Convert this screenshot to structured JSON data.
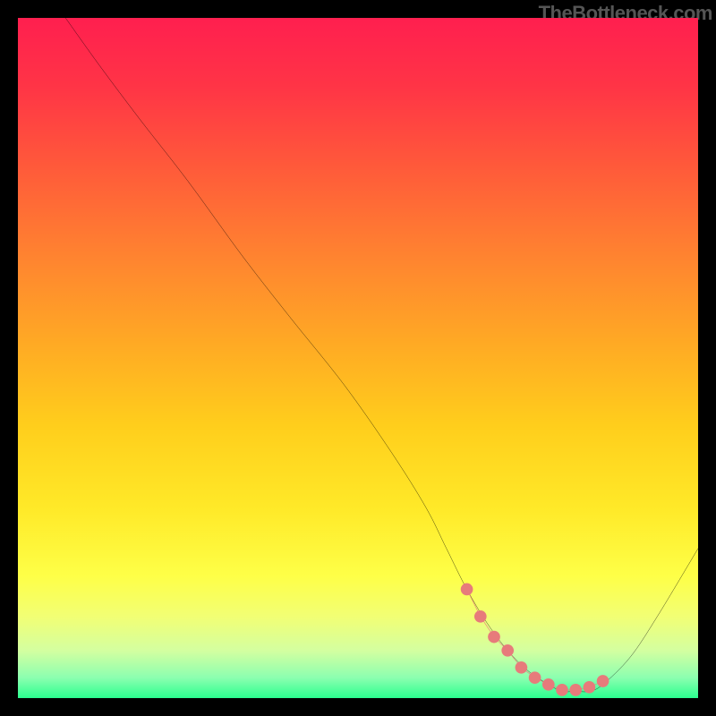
{
  "attribution": "TheBottleneck.com",
  "gradient_stops": [
    {
      "offset": 0.0,
      "color": "#ff1f4f"
    },
    {
      "offset": 0.1,
      "color": "#ff3446"
    },
    {
      "offset": 0.22,
      "color": "#ff5a3a"
    },
    {
      "offset": 0.35,
      "color": "#ff8330"
    },
    {
      "offset": 0.48,
      "color": "#ffaa24"
    },
    {
      "offset": 0.6,
      "color": "#ffce1c"
    },
    {
      "offset": 0.72,
      "color": "#ffe928"
    },
    {
      "offset": 0.82,
      "color": "#feff47"
    },
    {
      "offset": 0.88,
      "color": "#f2ff74"
    },
    {
      "offset": 0.93,
      "color": "#d4ffa0"
    },
    {
      "offset": 0.97,
      "color": "#8cffb0"
    },
    {
      "offset": 1.0,
      "color": "#2bff8f"
    }
  ],
  "chart_data": {
    "type": "line",
    "title": "",
    "xlabel": "",
    "ylabel": "",
    "xlim": [
      0,
      100
    ],
    "ylim": [
      0,
      100
    ],
    "series": [
      {
        "name": "bottleneck-curve",
        "x": [
          7,
          12,
          18,
          25,
          33,
          40,
          48,
          55,
          60,
          63,
          66,
          69,
          72,
          75,
          78,
          80,
          82,
          84,
          86,
          90,
          94,
          100
        ],
        "y": [
          100,
          93,
          85,
          76,
          65,
          56,
          46,
          36,
          28,
          22,
          16,
          11,
          7,
          4,
          2,
          1,
          1,
          1,
          2,
          6,
          12,
          22
        ]
      }
    ],
    "markers": {
      "name": "valley-markers",
      "color": "#e77b7b",
      "x": [
        66,
        68,
        70,
        72,
        74,
        76,
        78,
        80,
        82,
        84,
        86
      ],
      "y": [
        16,
        12,
        9,
        7,
        4.5,
        3,
        2,
        1.2,
        1.2,
        1.6,
        2.5
      ]
    }
  }
}
